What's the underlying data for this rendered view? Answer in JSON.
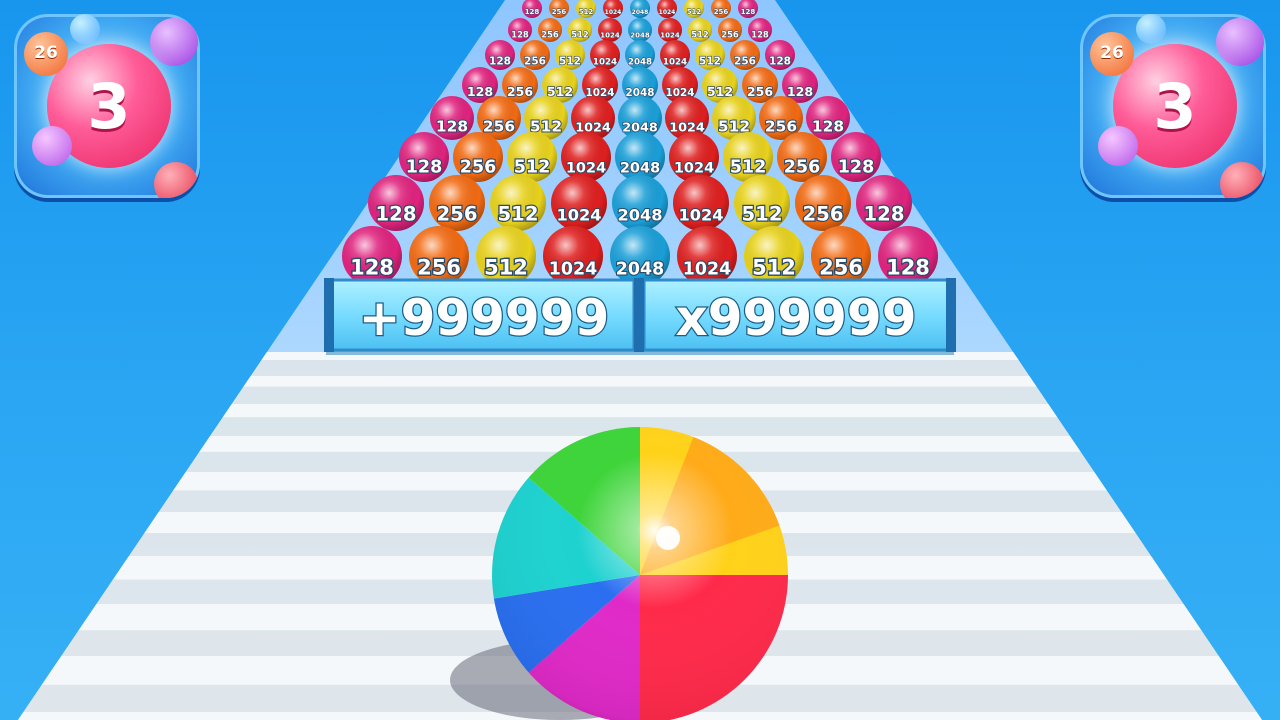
{
  "level_icon_left": {
    "level": "3",
    "badge": "26"
  },
  "level_icon_right": {
    "level": "3",
    "badge": "26"
  },
  "gates": [
    {
      "label": "+999999"
    },
    {
      "label": "x999999"
    }
  ],
  "ball_rows": [
    [
      "128",
      "256",
      "512",
      "1024",
      "2048",
      "1024",
      "512",
      "256",
      "128"
    ],
    [
      "128",
      "256",
      "512",
      "1024",
      "2048",
      "1024",
      "512",
      "256",
      "128"
    ],
    [
      "128",
      "256",
      "512",
      "1024",
      "2048",
      "1024",
      "512",
      "256",
      "128"
    ],
    [
      "128",
      "256",
      "512",
      "1024",
      "2048",
      "1024",
      "512",
      "256",
      "128"
    ],
    [
      "128",
      "256",
      "512",
      "1024",
      "2048",
      "1024",
      "512",
      "256",
      "128"
    ],
    [
      "128",
      "256",
      "512",
      "1024",
      "2048",
      "1024",
      "512",
      "256",
      "128"
    ],
    [
      "128",
      "256",
      "512",
      "1024",
      "2048",
      "1024",
      "512",
      "256",
      "128"
    ],
    [
      "128",
      "256",
      "512",
      "1024",
      "2048",
      "1024",
      "512",
      "256",
      "128"
    ]
  ],
  "ball_colors": {
    "128": "#e0237e",
    "256": "#f26a12",
    "512": "#e8d21c",
    "1024": "#df1f1f",
    "2048": "#1a9fd8"
  },
  "player_ball": "rainbow"
}
